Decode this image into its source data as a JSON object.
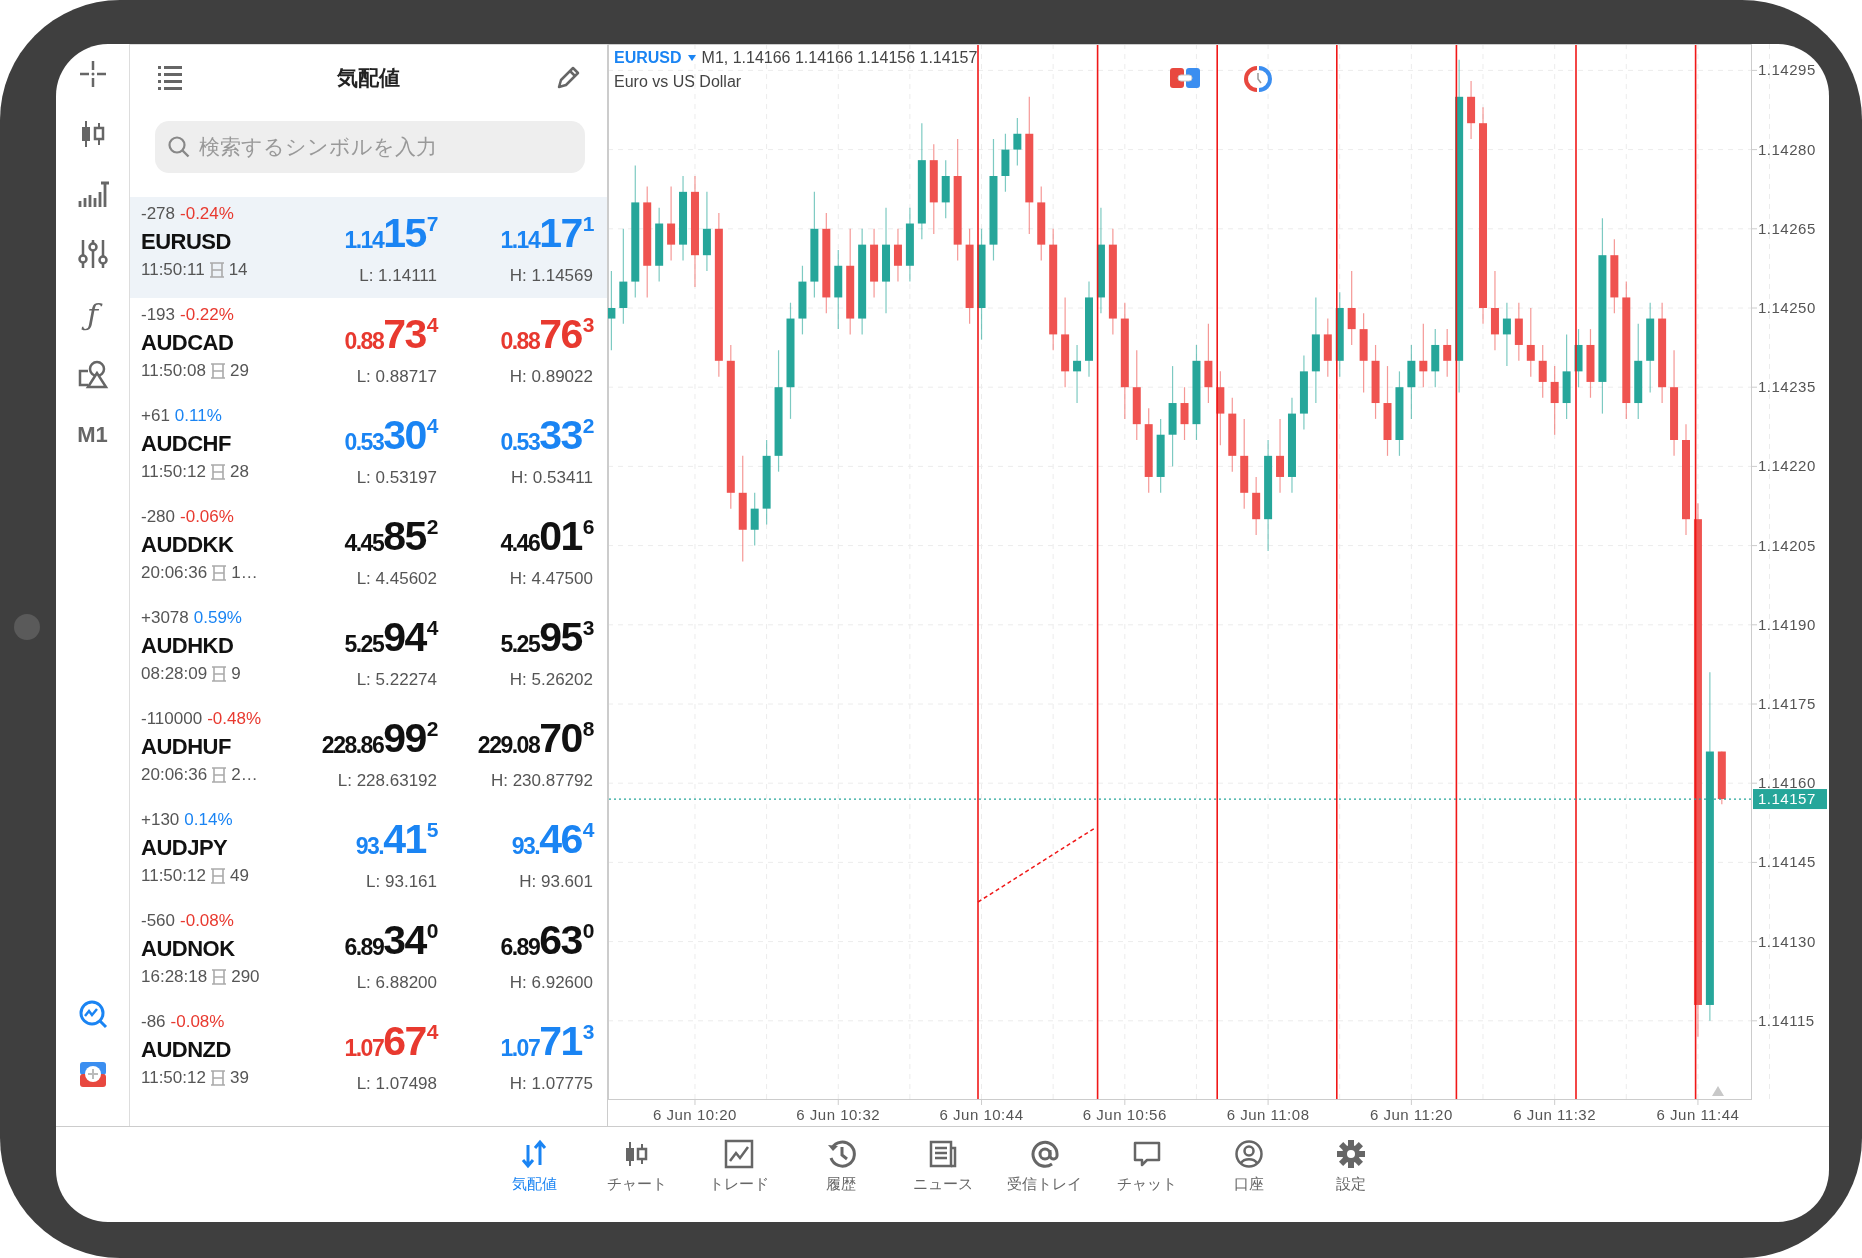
{
  "side_toolbar": {
    "function_glyph": "ƒ",
    "timeframe": "M1"
  },
  "watchlist": {
    "title": "気配値",
    "search": {
      "placeholder": "検索するシンボルを入力"
    },
    "quotes": [
      {
        "selected": true,
        "change": "-278",
        "percent": {
          "text": "-0.24%",
          "color": "#e8392f"
        },
        "symbol": "EURUSD",
        "time": "11:50:11",
        "spread": "14",
        "bid": {
          "head": "1.14",
          "big": "15",
          "tail": "7",
          "color": "#1a84f3"
        },
        "ask": {
          "head": "1.14",
          "big": "17",
          "tail": "1",
          "color": "#1a84f3"
        },
        "low": "L: 1.14111",
        "high": "H: 1.14569"
      },
      {
        "selected": false,
        "change": "-193",
        "percent": {
          "text": "-0.22%",
          "color": "#e8392f"
        },
        "symbol": "AUDCAD",
        "time": "11:50:08",
        "spread": "29",
        "bid": {
          "head": "0.88",
          "big": "73",
          "tail": "4",
          "color": "#e8392f"
        },
        "ask": {
          "head": "0.88",
          "big": "76",
          "tail": "3",
          "color": "#e8392f"
        },
        "low": "L: 0.88717",
        "high": "H: 0.89022"
      },
      {
        "selected": false,
        "change": "+61",
        "percent": {
          "text": "0.11%",
          "color": "#1a84f3"
        },
        "symbol": "AUDCHF",
        "time": "11:50:12",
        "spread": "28",
        "bid": {
          "head": "0.53",
          "big": "30",
          "tail": "4",
          "color": "#1a84f3"
        },
        "ask": {
          "head": "0.53",
          "big": "33",
          "tail": "2",
          "color": "#1a84f3"
        },
        "low": "L: 0.53197",
        "high": "H: 0.53411"
      },
      {
        "selected": false,
        "change": "-280",
        "percent": {
          "text": "-0.06%",
          "color": "#e8392f"
        },
        "symbol": "AUDDKK",
        "time": "20:06:36",
        "spread": "1…",
        "bid": {
          "head": "4.45",
          "big": "85",
          "tail": "2",
          "color": "#111111"
        },
        "ask": {
          "head": "4.46",
          "big": "01",
          "tail": "6",
          "color": "#111111"
        },
        "low": "L: 4.45602",
        "high": "H: 4.47500"
      },
      {
        "selected": false,
        "change": "+3078",
        "percent": {
          "text": "0.59%",
          "color": "#1a84f3"
        },
        "symbol": "AUDHKD",
        "time": "08:28:09",
        "spread": "9",
        "bid": {
          "head": "5.25",
          "big": "94",
          "tail": "4",
          "color": "#111111"
        },
        "ask": {
          "head": "5.25",
          "big": "95",
          "tail": "3",
          "color": "#111111"
        },
        "low": "L: 5.22274",
        "high": "H: 5.26202"
      },
      {
        "selected": false,
        "change": "-110000",
        "percent": {
          "text": "-0.48%",
          "color": "#e8392f"
        },
        "symbol": "AUDHUF",
        "time": "20:06:36",
        "spread": "2…",
        "bid": {
          "head": "228.86",
          "big": "99",
          "tail": "2",
          "color": "#111111"
        },
        "ask": {
          "head": "229.08",
          "big": "70",
          "tail": "8",
          "color": "#111111"
        },
        "low": "L: 228.63192",
        "high": "H: 230.87792"
      },
      {
        "selected": false,
        "change": "+130",
        "percent": {
          "text": "0.14%",
          "color": "#1a84f3"
        },
        "symbol": "AUDJPY",
        "time": "11:50:12",
        "spread": "49",
        "bid": {
          "head": "93.",
          "big": "41",
          "tail": "5",
          "color": "#1a84f3"
        },
        "ask": {
          "head": "93.",
          "big": "46",
          "tail": "4",
          "color": "#1a84f3"
        },
        "low": "L: 93.161",
        "high": "H: 93.601"
      },
      {
        "selected": false,
        "change": "-560",
        "percent": {
          "text": "-0.08%",
          "color": "#e8392f"
        },
        "symbol": "AUDNOK",
        "time": "16:28:18",
        "spread": "290",
        "bid": {
          "head": "6.89",
          "big": "34",
          "tail": "0",
          "color": "#111111"
        },
        "ask": {
          "head": "6.89",
          "big": "63",
          "tail": "0",
          "color": "#111111"
        },
        "low": "L: 6.88200",
        "high": "H: 6.92600"
      },
      {
        "selected": false,
        "change": "-86",
        "percent": {
          "text": "-0.08%",
          "color": "#e8392f"
        },
        "symbol": "AUDNZD",
        "time": "11:50:12",
        "spread": "39",
        "bid": {
          "head": "1.07",
          "big": "67",
          "tail": "4",
          "color": "#e8392f"
        },
        "ask": {
          "head": "1.07",
          "big": "71",
          "tail": "3",
          "color": "#1a84f3"
        },
        "low": "L: 1.07498",
        "high": "H: 1.07775"
      }
    ]
  },
  "chart": {
    "symbol": "EURUSD",
    "info": "M1, 1.14166 1.14166 1.14156 1.14157",
    "description": "Euro vs US Dollar",
    "chart_data": {
      "type": "candlestick",
      "grid": true,
      "categories": [
        null,
        null,
        null,
        null,
        null,
        null,
        null,
        "6 Jun 10:20",
        null,
        null,
        null,
        null,
        null,
        null,
        null,
        null,
        null,
        null,
        null,
        "6 Jun 10:32",
        null,
        null,
        null,
        null,
        null,
        null,
        null,
        null,
        null,
        null,
        null,
        "6 Jun 10:44",
        null,
        null,
        null,
        null,
        null,
        null,
        null,
        null,
        null,
        null,
        null,
        "6 Jun 10:56",
        null,
        null,
        null,
        null,
        null,
        null,
        null,
        null,
        null,
        null,
        null,
        "6 Jun 11:08",
        null,
        null,
        null,
        null,
        null,
        null,
        null,
        null,
        null,
        null,
        null,
        "6 Jun 11:20",
        null,
        null,
        null,
        null,
        null,
        null,
        null,
        null,
        null,
        null,
        null,
        "6 Jun 11:32",
        null,
        null,
        null,
        null,
        null,
        null,
        null,
        null,
        null,
        null,
        null,
        "6 Jun 11:44",
        null,
        null
      ],
      "ohlc": [
        [
          1.14248,
          1.14257,
          1.14242,
          1.1425
        ],
        [
          1.1425,
          1.14265,
          1.14247,
          1.14255
        ],
        [
          1.14255,
          1.14277,
          1.14252,
          1.1427
        ],
        [
          1.1427,
          1.14273,
          1.14252,
          1.14258
        ],
        [
          1.14258,
          1.14269,
          1.14255,
          1.14266
        ],
        [
          1.14266,
          1.14273,
          1.14259,
          1.14262
        ],
        [
          1.14262,
          1.14275,
          1.14259,
          1.14272
        ],
        [
          1.14272,
          1.14275,
          1.14254,
          1.1426
        ],
        [
          1.1426,
          1.14272,
          1.14257,
          1.14265
        ],
        [
          1.14265,
          1.14268,
          1.14237,
          1.1424
        ],
        [
          1.1424,
          1.14243,
          1.14212,
          1.14215
        ],
        [
          1.14215,
          1.14222,
          1.14202,
          1.14208
        ],
        [
          1.14208,
          1.14215,
          1.14205,
          1.14212
        ],
        [
          1.14212,
          1.14225,
          1.14209,
          1.14222
        ],
        [
          1.14222,
          1.14242,
          1.14219,
          1.14235
        ],
        [
          1.14235,
          1.14251,
          1.14229,
          1.14248
        ],
        [
          1.14248,
          1.14258,
          1.14245,
          1.14255
        ],
        [
          1.14255,
          1.14272,
          1.14252,
          1.14265
        ],
        [
          1.14265,
          1.14268,
          1.14249,
          1.14252
        ],
        [
          1.14252,
          1.14261,
          1.14246,
          1.14258
        ],
        [
          1.14258,
          1.14265,
          1.14245,
          1.14248
        ],
        [
          1.14248,
          1.14265,
          1.14245,
          1.14262
        ],
        [
          1.14262,
          1.14265,
          1.14252,
          1.14255
        ],
        [
          1.14255,
          1.14269,
          1.14249,
          1.14262
        ],
        [
          1.14262,
          1.14265,
          1.14255,
          1.14258
        ],
        [
          1.14258,
          1.14269,
          1.14255,
          1.14266
        ],
        [
          1.14266,
          1.14285,
          1.14263,
          1.14278
        ],
        [
          1.14278,
          1.14281,
          1.14264,
          1.1427
        ],
        [
          1.1427,
          1.14278,
          1.14267,
          1.14275
        ],
        [
          1.14275,
          1.14282,
          1.14259,
          1.14262
        ],
        [
          1.14262,
          1.14265,
          1.14247,
          1.1425
        ],
        [
          1.1425,
          1.14265,
          1.14244,
          1.14262
        ],
        [
          1.14262,
          1.14282,
          1.14259,
          1.14275
        ],
        [
          1.14275,
          1.14283,
          1.14272,
          1.1428
        ],
        [
          1.1428,
          1.14286,
          1.14277,
          1.14283
        ],
        [
          1.14283,
          1.1429,
          1.14264,
          1.1427
        ],
        [
          1.1427,
          1.14273,
          1.14259,
          1.14262
        ],
        [
          1.14262,
          1.14265,
          1.14242,
          1.14245
        ],
        [
          1.14245,
          1.14252,
          1.14235,
          1.14238
        ],
        [
          1.14238,
          1.14243,
          1.14232,
          1.1424
        ],
        [
          1.1424,
          1.14255,
          1.14237,
          1.14252
        ],
        [
          1.14252,
          1.14269,
          1.14249,
          1.14262
        ],
        [
          1.14262,
          1.14265,
          1.14245,
          1.14248
        ],
        [
          1.14248,
          1.14251,
          1.14229,
          1.14235
        ],
        [
          1.14235,
          1.14242,
          1.14225,
          1.14228
        ],
        [
          1.14228,
          1.14231,
          1.14215,
          1.14218
        ],
        [
          1.14218,
          1.14229,
          1.14215,
          1.14226
        ],
        [
          1.14226,
          1.14239,
          1.1422,
          1.14232
        ],
        [
          1.14232,
          1.14235,
          1.14225,
          1.14228
        ],
        [
          1.14228,
          1.14243,
          1.14225,
          1.1424
        ],
        [
          1.1424,
          1.14247,
          1.14232,
          1.14235
        ],
        [
          1.14235,
          1.14238,
          1.14224,
          1.1423
        ],
        [
          1.1423,
          1.14233,
          1.14219,
          1.14222
        ],
        [
          1.14222,
          1.14229,
          1.14212,
          1.14215
        ],
        [
          1.14215,
          1.14218,
          1.14207,
          1.1421
        ],
        [
          1.1421,
          1.14225,
          1.14204,
          1.14222
        ],
        [
          1.14222,
          1.14229,
          1.14215,
          1.14218
        ],
        [
          1.14218,
          1.14233,
          1.14215,
          1.1423
        ],
        [
          1.1423,
          1.14241,
          1.14227,
          1.14238
        ],
        [
          1.14238,
          1.14252,
          1.14232,
          1.14245
        ],
        [
          1.14245,
          1.14248,
          1.14237,
          1.1424
        ],
        [
          1.1424,
          1.14253,
          1.14237,
          1.1425
        ],
        [
          1.1425,
          1.14257,
          1.14243,
          1.14246
        ],
        [
          1.14246,
          1.14249,
          1.14234,
          1.1424
        ],
        [
          1.1424,
          1.14243,
          1.14229,
          1.14232
        ],
        [
          1.14232,
          1.14239,
          1.14222,
          1.14225
        ],
        [
          1.14225,
          1.14238,
          1.14222,
          1.14235
        ],
        [
          1.14235,
          1.14243,
          1.14229,
          1.1424
        ],
        [
          1.1424,
          1.14247,
          1.14235,
          1.14238
        ],
        [
          1.14238,
          1.14246,
          1.14235,
          1.14243
        ],
        [
          1.14243,
          1.14246,
          1.14237,
          1.1424
        ],
        [
          1.1424,
          1.14297,
          1.14234,
          1.1429
        ],
        [
          1.1429,
          1.14293,
          1.14282,
          1.14285
        ],
        [
          1.14285,
          1.14288,
          1.14247,
          1.1425
        ],
        [
          1.1425,
          1.14257,
          1.14242,
          1.14245
        ],
        [
          1.14245,
          1.14251,
          1.14239,
          1.14248
        ],
        [
          1.14248,
          1.14251,
          1.1424,
          1.14243
        ],
        [
          1.14243,
          1.1425,
          1.14237,
          1.1424
        ],
        [
          1.1424,
          1.14243,
          1.14233,
          1.14236
        ],
        [
          1.14236,
          1.14239,
          1.14226,
          1.14232
        ],
        [
          1.14232,
          1.14245,
          1.14229,
          1.14238
        ],
        [
          1.14238,
          1.14246,
          1.14235,
          1.14243
        ],
        [
          1.14243,
          1.14246,
          1.14233,
          1.14236
        ],
        [
          1.14236,
          1.14267,
          1.1423,
          1.1426
        ],
        [
          1.1426,
          1.14263,
          1.14249,
          1.14252
        ],
        [
          1.14252,
          1.14255,
          1.14229,
          1.14232
        ],
        [
          1.14232,
          1.14247,
          1.14229,
          1.1424
        ],
        [
          1.1424,
          1.14251,
          1.14234,
          1.14248
        ],
        [
          1.14248,
          1.14251,
          1.14232,
          1.14235
        ],
        [
          1.14235,
          1.14242,
          1.14222,
          1.14225
        ],
        [
          1.14225,
          1.14228,
          1.14207,
          1.1421
        ],
        [
          1.1421,
          1.14213,
          1.14112,
          1.14118
        ],
        [
          1.14118,
          1.14181,
          1.14115,
          1.14166
        ],
        [
          1.14166,
          1.14166,
          1.14156,
          1.14157
        ]
      ],
      "ylim": [
        1.141,
        1.143
      ],
      "yticks": [
        {
          "value": 1.14295,
          "label": "1.14295"
        },
        {
          "value": 1.1428,
          "label": "1.14280"
        },
        {
          "value": 1.14265,
          "label": "1.14265"
        },
        {
          "value": 1.1425,
          "label": "1.14250"
        },
        {
          "value": 1.14235,
          "label": "1.14235"
        },
        {
          "value": 1.1422,
          "label": "1.14220"
        },
        {
          "value": 1.14205,
          "label": "1.14205"
        },
        {
          "value": 1.1419,
          "label": "1.14190"
        },
        {
          "value": 1.14175,
          "label": "1.14175"
        },
        {
          "value": 1.1416,
          "label": "1.14160"
        },
        {
          "value": 1.14145,
          "label": "1.14145"
        },
        {
          "value": 1.1413,
          "label": "1.14130"
        },
        {
          "value": 1.14115,
          "label": "1.14115"
        }
      ],
      "ref_lines": [
        {
          "axis": "y",
          "value": 1.14157,
          "label": "1.14157",
          "color": "#26a69a"
        }
      ]
    }
  },
  "bottom_nav": [
    {
      "label": "気配値",
      "selected": true
    },
    {
      "label": "チャート",
      "selected": false
    },
    {
      "label": "トレード",
      "selected": false
    },
    {
      "label": "履歴",
      "selected": false
    },
    {
      "label": "ニュース",
      "selected": false
    },
    {
      "label": "受信トレイ",
      "selected": false
    },
    {
      "label": "チャット",
      "selected": false
    },
    {
      "label": "口座",
      "selected": false
    },
    {
      "label": "設定",
      "selected": false
    }
  ]
}
